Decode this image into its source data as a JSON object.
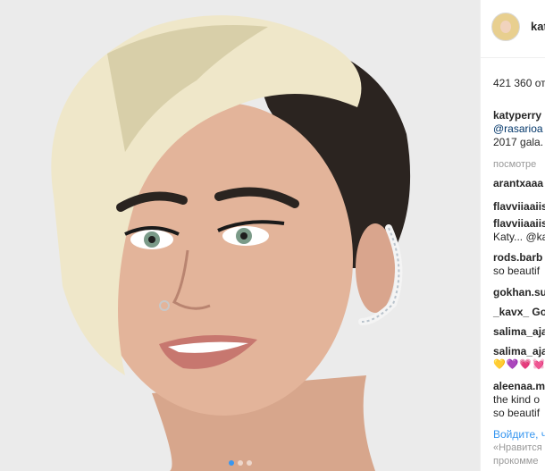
{
  "post": {
    "photo_alt": "Портрет женщины с короткой стрижкой",
    "carousel_dots": 3
  },
  "header": {
    "username": "kat"
  },
  "likes_text": "421 360 от",
  "caption": {
    "username": "katyperry",
    "line2": "@rasarioa",
    "line3": "2017 gala."
  },
  "see_all": "посмотре",
  "comments": [
    {
      "lines": [
        "arantxaaa"
      ]
    },
    {
      "lines": [
        "flavviiaaiis"
      ]
    },
    {
      "lines": [
        "flavviiaaiis",
        "Katy... @ka"
      ]
    },
    {
      "lines": [
        "rods.barb",
        "so beautif"
      ]
    },
    {
      "lines": [
        "gokhan.su"
      ]
    },
    {
      "lines": [
        "_kavx_ Go"
      ]
    },
    {
      "lines": [
        "salima_aja"
      ]
    },
    {
      "lines": [
        "salima_aja",
        "💛💜💗💓"
      ]
    },
    {
      "lines": [
        "aleenaa.m",
        "the kind o",
        "so beautif"
      ]
    }
  ],
  "footer": {
    "login": "Войдите, ч",
    "line1": "«Нравится",
    "line2": "прокомме"
  },
  "colors": {
    "link": "#003569",
    "accent": "#3897f0",
    "muted": "#999999"
  }
}
